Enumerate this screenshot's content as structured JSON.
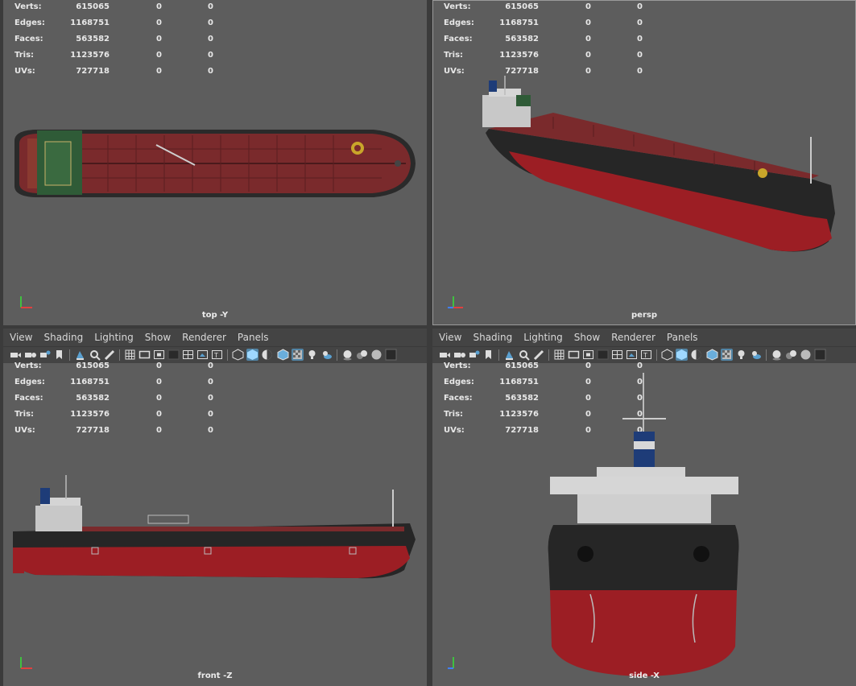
{
  "panels": [
    {
      "id": "top",
      "camera": "top -Y",
      "show_menubar": false
    },
    {
      "id": "persp",
      "camera": "persp",
      "show_menubar": false
    },
    {
      "id": "front",
      "camera": "front -Z",
      "show_menubar": true
    },
    {
      "id": "side",
      "camera": "side -X",
      "show_menubar": true
    }
  ],
  "menubar": {
    "items": [
      "View",
      "Shading",
      "Lighting",
      "Show",
      "Renderer",
      "Panels"
    ]
  },
  "hud": {
    "rows": [
      {
        "label": "Verts:",
        "v1": "615065",
        "v2": "0",
        "v3": "0"
      },
      {
        "label": "Edges:",
        "v1": "1168751",
        "v2": "0",
        "v3": "0"
      },
      {
        "label": "Faces:",
        "v1": "563582",
        "v2": "0",
        "v3": "0"
      },
      {
        "label": "Tris:",
        "v1": "1123576",
        "v2": "0",
        "v3": "0"
      },
      {
        "label": "UVs:",
        "v1": "727718",
        "v2": "0",
        "v3": "0"
      }
    ]
  },
  "axis_labels": {
    "x": "x",
    "y": "y",
    "z": "z"
  },
  "toolbar_icons": [
    "camera-icon",
    "camera-attrs-icon",
    "bookmark-icon",
    "image-plane-icon",
    "grease-pencil-icon",
    "2d-pan-icon",
    "grid-icon",
    "film-gate-icon",
    "resolution-gate-icon",
    "gate-mask-icon",
    "field-chart-icon",
    "safe-action-icon",
    "wireframe-icon",
    "smooth-shade-icon",
    "default-lighting-icon",
    "wireframe-on-shaded-icon",
    "xray-icon",
    "use-lights-icon",
    "shadows-icon",
    "ambient-occlusion-icon",
    "motion-blur-icon",
    "anti-alias-icon",
    "isolate-icon"
  ],
  "colors": {
    "viewport_bg": "#5d5d5d",
    "deck": "#7a2a2c",
    "hull_red": "#9c1e24",
    "hull_black": "#262626",
    "superstructure": "#c8c8c8",
    "bridge_deck": "#2f5b37",
    "toolbar_selected": "#5285a6",
    "axis_x": "#e04040",
    "axis_y": "#40c040",
    "axis_z": "#4080ff"
  }
}
